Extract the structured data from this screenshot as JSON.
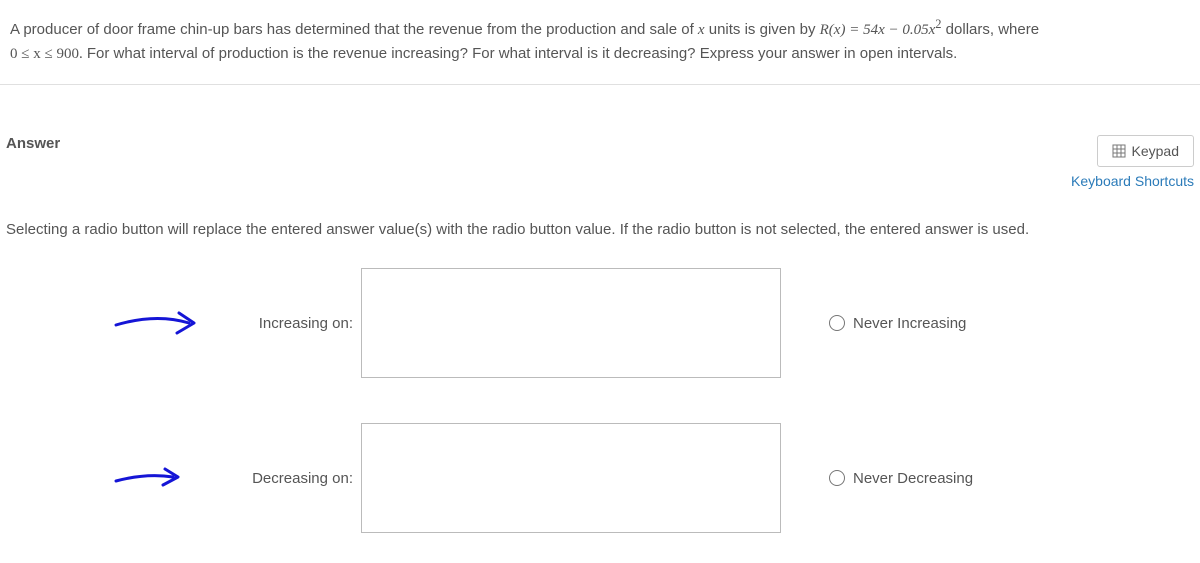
{
  "question": {
    "text_prefix": "A producer of door frame chin-up bars has determined that the revenue from the production and sale of ",
    "var_x": "x",
    "text_mid1": " units is given by ",
    "func": "R(x) = 54x − 0.05x",
    "exp": "2",
    "text_mid2": " dollars, where ",
    "domain": "0 ≤ x ≤ 900.",
    "text_end": "  For what interval of production is the revenue increasing?  For what interval is it decreasing?  Express your answer in open intervals."
  },
  "answer_label": "Answer",
  "keypad_label": "Keypad",
  "shortcuts_label": "Keyboard Shortcuts",
  "instruction": "Selecting a radio button will replace the entered answer value(s) with the radio button value. If the radio button is not selected, the entered answer is used.",
  "increasing": {
    "label": "Increasing on:",
    "value": "",
    "radio_label": "Never Increasing"
  },
  "decreasing": {
    "label": "Decreasing on:",
    "value": "",
    "radio_label": "Never Decreasing"
  }
}
